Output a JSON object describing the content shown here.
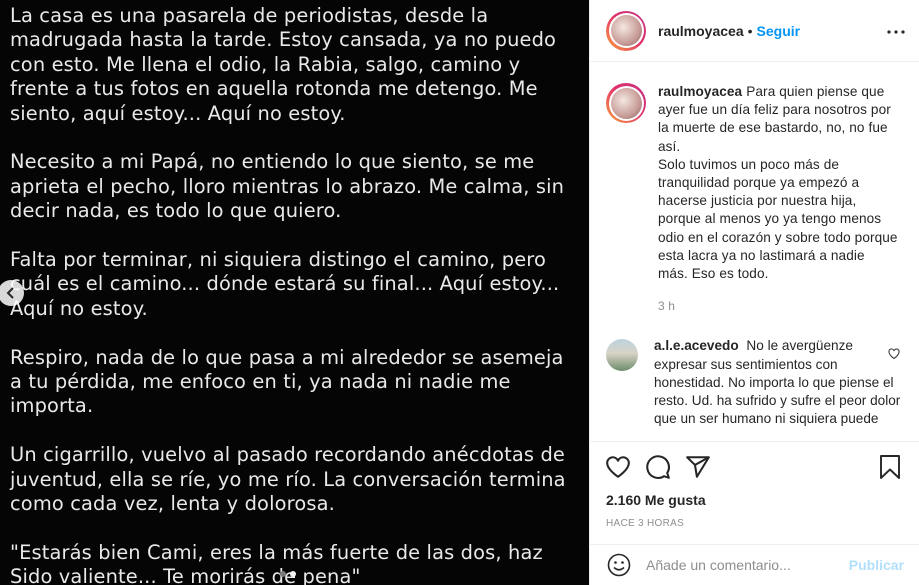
{
  "media": {
    "paragraphs": [
      "La casa es una pasarela de periodistas, desde la madrugada hasta la tarde. Estoy cansada, ya no puedo con esto. Me llena el odio, la Rabia, salgo, camino y frente a tus fotos en aquella rotonda me detengo. Me siento, aquí estoy... Aquí no estoy.",
      "Necesito a mi Papá, no entiendo lo que siento, se me aprieta el pecho, lloro mientras lo abrazo. Me calma, sin decir nada, es todo lo que quiero.",
      "Falta por terminar, ni siquiera distingo el camino, pero cuál es el camino... dónde estará su final... Aquí estoy... Aquí no estoy.",
      "Respiro, nada de lo que pasa a mi alrededor se asemeja a tu pérdida, me enfoco en ti, ya nada ni nadie me importa.",
      "Un cigarrillo, vuelvo al pasado recordando anécdotas de juventud, ella se ríe, yo me río. La conversación termina como cada vez, lenta y dolorosa.",
      "\"Estarás bien Cami, eres la más fuerte de las dos, haz Sido valiente... Te morirás de pena\""
    ],
    "icons": {
      "prev": "chevron-left-icon"
    }
  },
  "header": {
    "username": "raulmoyacea",
    "separator": "•",
    "follow_label": "Seguir",
    "more_icon": "more-horizontal-icon"
  },
  "caption": {
    "username": "raulmoyacea",
    "lines": [
      "Para quien piense que ayer fue un día feliz para nosotros por la muerte de ese bastardo, no, no fue así.",
      "Solo tuvimos un poco más de tranquilidad porque ya empezó a hacerse justicia por nuestra hija, porque al menos yo ya tengo menos odio en el corazón y sobre todo porque esta lacra ya no lastimará a nadie más. Eso es todo."
    ],
    "time": "3 h"
  },
  "comments": [
    {
      "username": "a.l.e.acevedo",
      "text": "No le avergüenze expresar sus sentimientos con honestidad. No importa lo que piense el resto. Ud. ha sufrido y sufre el peor dolor que un ser humano ni siquiera puede"
    }
  ],
  "actions": {
    "icons": [
      "heart-icon",
      "comment-icon",
      "share-icon",
      "bookmark-icon"
    ],
    "likes_label": "2.160 Me gusta",
    "time_ago": "HACE 3 HORAS"
  },
  "add_comment": {
    "placeholder": "Añade un comentario...",
    "publish_label": "Publicar"
  },
  "colors": {
    "accent": "#0095f6",
    "publish_disabled": "#b2dffc",
    "media_bg": "#050505",
    "media_text": "#e9e9e9"
  }
}
